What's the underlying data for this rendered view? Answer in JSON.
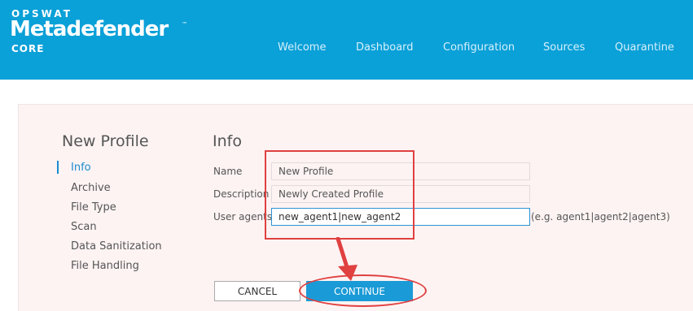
{
  "brand": {
    "top": "OPSWAT",
    "main": "Metadefender",
    "sub": "CORE",
    "trademark": "™"
  },
  "nav": {
    "items": [
      {
        "label": "Welcome"
      },
      {
        "label": "Dashboard"
      },
      {
        "label": "Configuration"
      },
      {
        "label": "Sources"
      },
      {
        "label": "Quarantine"
      }
    ]
  },
  "sidebar": {
    "title": "New Profile",
    "items": [
      {
        "label": "Info",
        "active": true
      },
      {
        "label": "Archive"
      },
      {
        "label": "File Type"
      },
      {
        "label": "Scan"
      },
      {
        "label": "Data Sanitization"
      },
      {
        "label": "File Handling"
      }
    ]
  },
  "form": {
    "title": "Info",
    "name_label": "Name",
    "name_value": "New Profile",
    "description_label": "Description",
    "description_value": "Newly Created Profile",
    "user_agents_label": "User agents",
    "user_agents_value": "new_agent1|new_agent2",
    "user_agents_hint": "(e.g. agent1|agent2|agent3)"
  },
  "buttons": {
    "cancel": "CANCEL",
    "continue": "CONTINUE"
  },
  "colors": {
    "header_bg": "#0aa0d8",
    "accent": "#1a9ad6",
    "annotation": "#e04040"
  }
}
